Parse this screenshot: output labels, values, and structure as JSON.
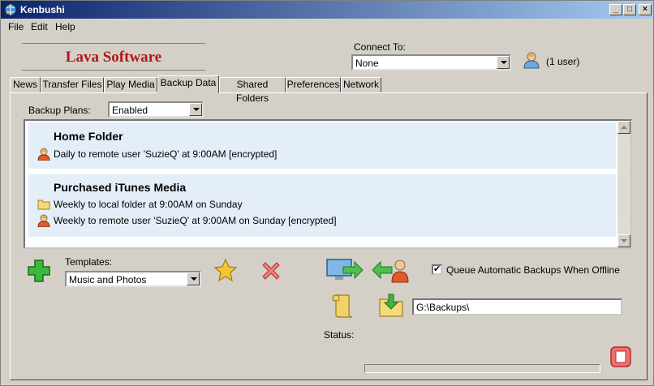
{
  "window": {
    "title": "Kenbushi"
  },
  "menu": [
    "File",
    "Edit",
    "Help"
  ],
  "logo": {
    "text": "Lava Software"
  },
  "connect": {
    "label": "Connect To:",
    "value": "None",
    "user_count": "(1 user)"
  },
  "tabs": [
    "News",
    "Transfer Files",
    "Play Media",
    "Backup Data",
    "Shared Folders",
    "Preferences",
    "Network"
  ],
  "active_tab": "Backup Data",
  "backup_plans": {
    "label": "Backup Plans:",
    "value": "Enabled"
  },
  "plans": [
    {
      "title": "Home Folder",
      "lines": [
        {
          "icon": "remote-user-icon",
          "text": "Daily to remote user 'SuzieQ' at 9:00AM [encrypted]"
        }
      ]
    },
    {
      "title": "Purchased iTunes Media",
      "lines": [
        {
          "icon": "folder-icon",
          "text": "Weekly to local folder at 9:00AM on Sunday"
        },
        {
          "icon": "remote-user-icon",
          "text": "Weekly to remote user 'SuzieQ' at 9:00AM on Sunday [encrypted]"
        }
      ]
    }
  ],
  "templates": {
    "label": "Templates:",
    "value": "Music and Photos"
  },
  "queue_offline": {
    "label": "Queue Automatic Backups When Offline",
    "checked": true
  },
  "backup_path": "G:\\Backups\\",
  "status": {
    "label": "Status:",
    "progress": 0
  },
  "colors": {
    "title_bar": "#0a246a",
    "logo_red": "#b01818",
    "plan_bg": "#e3eef9",
    "face": "#d4d0c8"
  }
}
